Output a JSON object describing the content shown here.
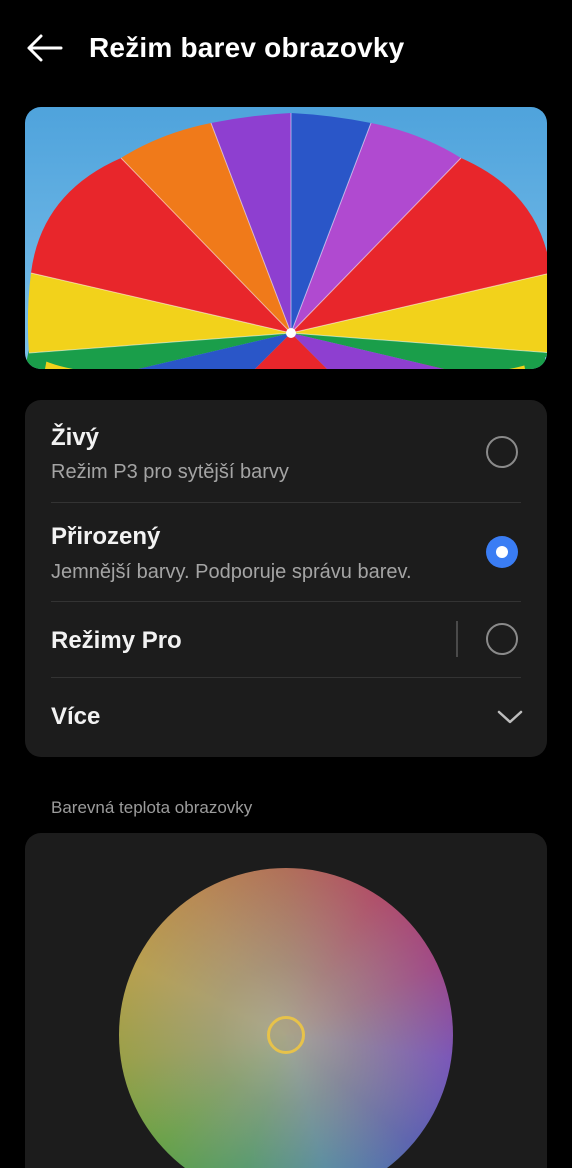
{
  "header": {
    "title": "Režim barev obrazovky",
    "back_icon": "arrow-left-icon"
  },
  "colors": {
    "background": "#000000",
    "card": "#1c1c1c",
    "accent": "#3a7df4",
    "secondary_text": "#a4a4a4",
    "knob": "#e7c24a"
  },
  "modes": {
    "vivid": {
      "title": "Živý",
      "subtitle": "Režim P3 pro sytější barvy",
      "selected": false
    },
    "natural": {
      "title": "Přirozený",
      "subtitle": "Jemnější barvy. Podporuje správu barev.",
      "selected": true
    },
    "pro": {
      "title": "Režimy Pro",
      "selected": false
    },
    "more": {
      "title": "Více",
      "icon": "chevron-down-icon"
    }
  },
  "temperature": {
    "label": "Barevná teplota obrazovky"
  }
}
